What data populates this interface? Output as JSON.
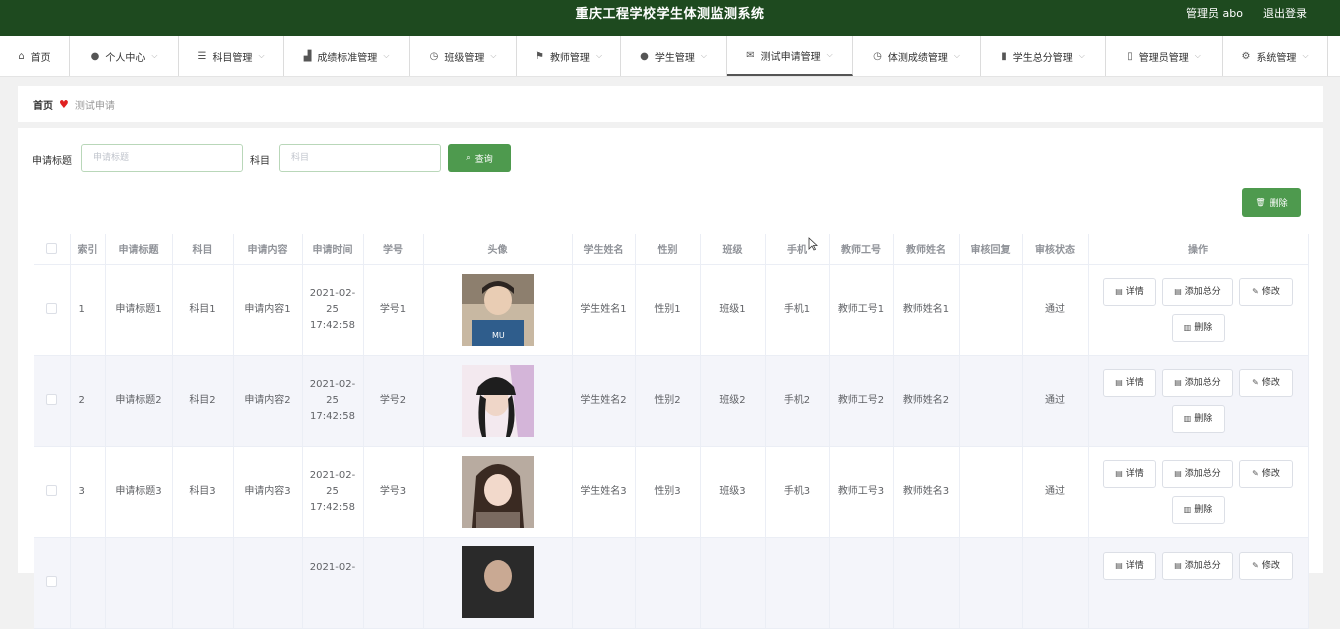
{
  "header": {
    "title": "重庆工程学校学生体测监测系统",
    "admin_label": "管理员 abo",
    "logout_label": "退出登录"
  },
  "nav": {
    "items": [
      {
        "label": "首页",
        "icon": "home-icon"
      },
      {
        "label": "个人中心",
        "icon": "user-icon"
      },
      {
        "label": "科目管理",
        "icon": "list-icon"
      },
      {
        "label": "成绩标准管理",
        "icon": "chart-icon"
      },
      {
        "label": "班级管理",
        "icon": "clock-icon"
      },
      {
        "label": "教师管理",
        "icon": "flag-icon"
      },
      {
        "label": "学生管理",
        "icon": "user-icon"
      },
      {
        "label": "测试申请管理",
        "icon": "mail-icon"
      },
      {
        "label": "体测成绩管理",
        "icon": "clock-icon"
      },
      {
        "label": "学生总分管理",
        "icon": "bars-icon"
      },
      {
        "label": "管理员管理",
        "icon": "phone-icon"
      },
      {
        "label": "系统管理",
        "icon": "gear-icon"
      }
    ]
  },
  "breadcrumb": {
    "home": "首页",
    "current": "测试申请"
  },
  "search": {
    "title_label": "申请标题",
    "title_placeholder": "申请标题",
    "subject_label": "科目",
    "subject_placeholder": "科目",
    "query_button": "查询"
  },
  "toolbar": {
    "delete_label": "删除"
  },
  "table": {
    "headers": [
      "索引",
      "申请标题",
      "科目",
      "申请内容",
      "申请时间",
      "学号",
      "头像",
      "学生姓名",
      "性别",
      "班级",
      "手机",
      "教师工号",
      "教师姓名",
      "审核回复",
      "审核状态",
      "操作"
    ],
    "rows": [
      {
        "index": "1",
        "title": "申请标题1",
        "subject": "科目1",
        "content": "申请内容1",
        "time": "2021-02-25 17:42:58",
        "student_no": "学号1",
        "name": "学生姓名1",
        "gender": "性别1",
        "class": "班级1",
        "phone": "手机1",
        "teacher_no": "教师工号1",
        "teacher_name": "教师姓名1",
        "reply": "",
        "status": "通过"
      },
      {
        "index": "2",
        "title": "申请标题2",
        "subject": "科目2",
        "content": "申请内容2",
        "time": "2021-02-25 17:42:58",
        "student_no": "学号2",
        "name": "学生姓名2",
        "gender": "性别2",
        "class": "班级2",
        "phone": "手机2",
        "teacher_no": "教师工号2",
        "teacher_name": "教师姓名2",
        "reply": "",
        "status": "通过"
      },
      {
        "index": "3",
        "title": "申请标题3",
        "subject": "科目3",
        "content": "申请内容3",
        "time": "2021-02-25 17:42:58",
        "student_no": "学号3",
        "name": "学生姓名3",
        "gender": "性别3",
        "class": "班级3",
        "phone": "手机3",
        "teacher_no": "教师工号3",
        "teacher_name": "教师姓名3",
        "reply": "",
        "status": "通过"
      },
      {
        "index": "",
        "title": "",
        "subject": "",
        "content": "",
        "time": "2021-02-",
        "student_no": "",
        "name": "",
        "gender": "",
        "class": "",
        "phone": "",
        "teacher_no": "",
        "teacher_name": "",
        "reply": "",
        "status": ""
      }
    ],
    "actions": {
      "detail": "详情",
      "add_score": "添加总分",
      "edit": "修改",
      "delete": "删除"
    }
  },
  "colors": {
    "header_bg": "#1e4a1f",
    "primary_button": "#4e9a4e",
    "breadcrumb_heart": "#e02020"
  }
}
